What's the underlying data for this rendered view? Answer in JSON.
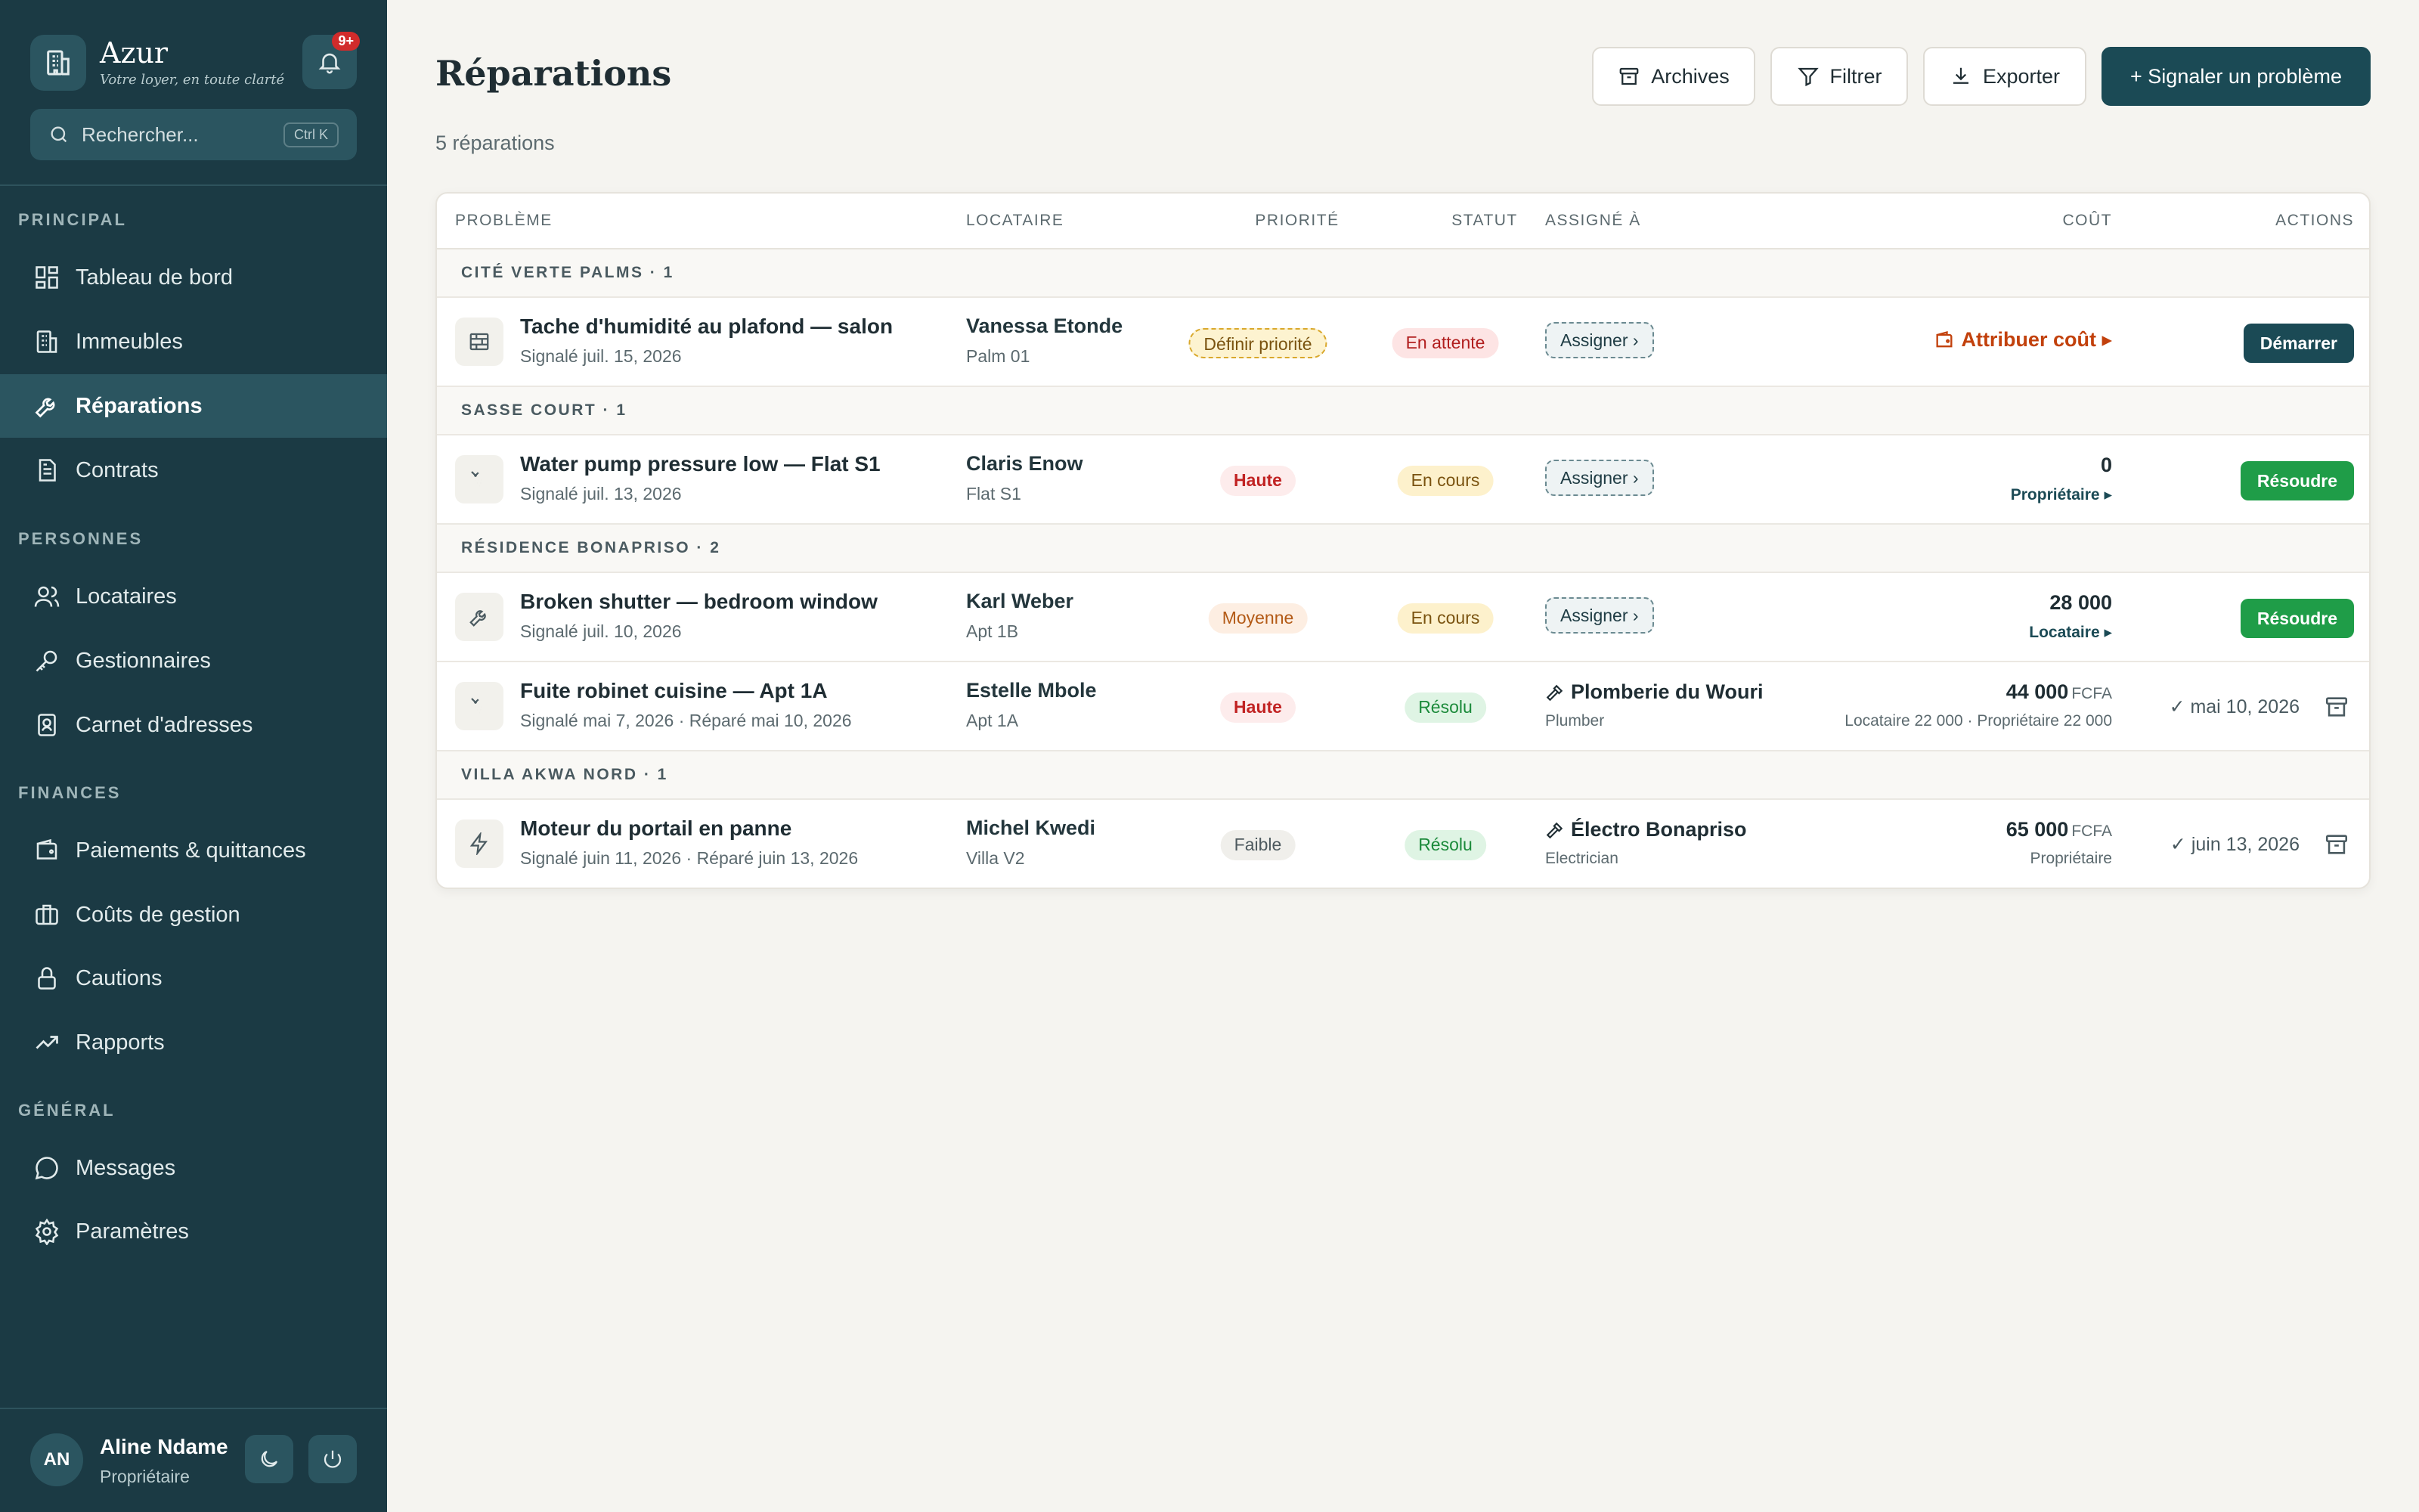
{
  "app": {
    "name": "Azur",
    "tagline": "Votre loyer, en toute clarté",
    "notif_badge": "9+"
  },
  "search": {
    "placeholder": "Rechercher...",
    "shortcut": "Ctrl K"
  },
  "sidebar": {
    "sections": [
      {
        "label": "PRINCIPAL",
        "items": [
          {
            "label": "Tableau de bord",
            "icon": "dashboard-icon"
          },
          {
            "label": "Immeubles",
            "icon": "building-icon"
          },
          {
            "label": "Réparations",
            "icon": "wrench-icon",
            "active": true
          },
          {
            "label": "Contrats",
            "icon": "document-icon"
          }
        ]
      },
      {
        "label": "PERSONNES",
        "items": [
          {
            "label": "Locataires",
            "icon": "users-icon"
          },
          {
            "label": "Gestionnaires",
            "icon": "key-icon"
          },
          {
            "label": "Carnet d'adresses",
            "icon": "contact-book-icon"
          }
        ]
      },
      {
        "label": "FINANCES",
        "items": [
          {
            "label": "Paiements & quittances",
            "icon": "wallet-icon"
          },
          {
            "label": "Coûts de gestion",
            "icon": "briefcase-icon"
          },
          {
            "label": "Cautions",
            "icon": "lock-icon"
          },
          {
            "label": "Rapports",
            "icon": "trend-icon"
          }
        ]
      },
      {
        "label": "GÉNÉRAL",
        "items": [
          {
            "label": "Messages",
            "icon": "chat-icon"
          },
          {
            "label": "Paramètres",
            "icon": "gear-icon"
          }
        ]
      }
    ]
  },
  "user": {
    "initials": "AN",
    "name": "Aline Ndame",
    "role": "Propriétaire"
  },
  "page": {
    "title": "Réparations",
    "count": "5 réparations"
  },
  "toolbar": {
    "archives": "Archives",
    "filter": "Filtrer",
    "export": "Exporter",
    "report": "+ Signaler un problème"
  },
  "table": {
    "columns": {
      "problem": "PROBLÈME",
      "tenant": "LOCATAIRE",
      "priority": "PRIORITÉ",
      "status": "STATUT",
      "assigned": "ASSIGNÉ À",
      "cost": "COÛT",
      "actions": "ACTIONS"
    },
    "groups": [
      {
        "label": "CITÉ VERTE PALMS · 1"
      },
      {
        "label": "SASSE COURT · 1"
      },
      {
        "label": "RÉSIDENCE BONAPRISO · 2"
      },
      {
        "label": "VILLA AKWA NORD · 1"
      }
    ],
    "rows": [
      {
        "icon": "wall-icon",
        "title": "Tache d'humidité au plafond — salon",
        "sub": "Signalé juil. 15, 2026",
        "tenant": "Vanessa Etonde",
        "unit": "Palm 01",
        "priority": "Définir priorité",
        "status": "En attente",
        "assign": "Assigner ›",
        "cost_attr": "Attribuer coût ▸",
        "action": "Démarrer"
      },
      {
        "icon": "shower-icon",
        "title": "Water pump pressure low — Flat S1",
        "sub": "Signalé juil. 13, 2026",
        "tenant": "Claris Enow",
        "unit": "Flat S1",
        "priority": "Haute",
        "status": "En cours",
        "assign": "Assigner ›",
        "cost": "0",
        "cost_link": "Propriétaire ▸",
        "action": "Résoudre"
      },
      {
        "icon": "wrench-icon",
        "title": "Broken shutter — bedroom window",
        "sub": "Signalé juil. 10, 2026",
        "tenant": "Karl Weber",
        "unit": "Apt 1B",
        "priority": "Moyenne",
        "status": "En cours",
        "assign": "Assigner ›",
        "cost": "28 000",
        "cost_link": "Locataire ▸",
        "action": "Résoudre"
      },
      {
        "icon": "shower-icon",
        "title": "Fuite robinet cuisine — Apt 1A",
        "sub": "Signalé mai 7, 2026 · Réparé mai 10, 2026",
        "tenant": "Estelle Mbole",
        "unit": "Apt 1A",
        "priority": "Haute",
        "status": "Résolu",
        "assignee": "Plomberie du Wouri",
        "assignee_role": "Plumber",
        "cost": "44 000",
        "currency": "FCFA",
        "cost_split": "Locataire 22 000 · Propriétaire 22 000",
        "done_date": "✓ mai 10, 2026"
      },
      {
        "icon": "bolt-icon",
        "title": "Moteur du portail en panne",
        "sub": "Signalé juin 11, 2026 · Réparé juin 13, 2026",
        "tenant": "Michel Kwedi",
        "unit": "Villa V2",
        "priority": "Faible",
        "status": "Résolu",
        "assignee": "Électro Bonapriso",
        "assignee_role": "Electrician",
        "cost": "65 000",
        "currency": "FCFA",
        "cost_split": "Propriétaire",
        "done_date": "✓ juin 13, 2026"
      }
    ]
  },
  "colors": {
    "sidebar": "#1b3a44",
    "accent": "#1b4a55",
    "success": "#1f9d48",
    "danger": "#c12323",
    "warning": "#c2410c"
  }
}
